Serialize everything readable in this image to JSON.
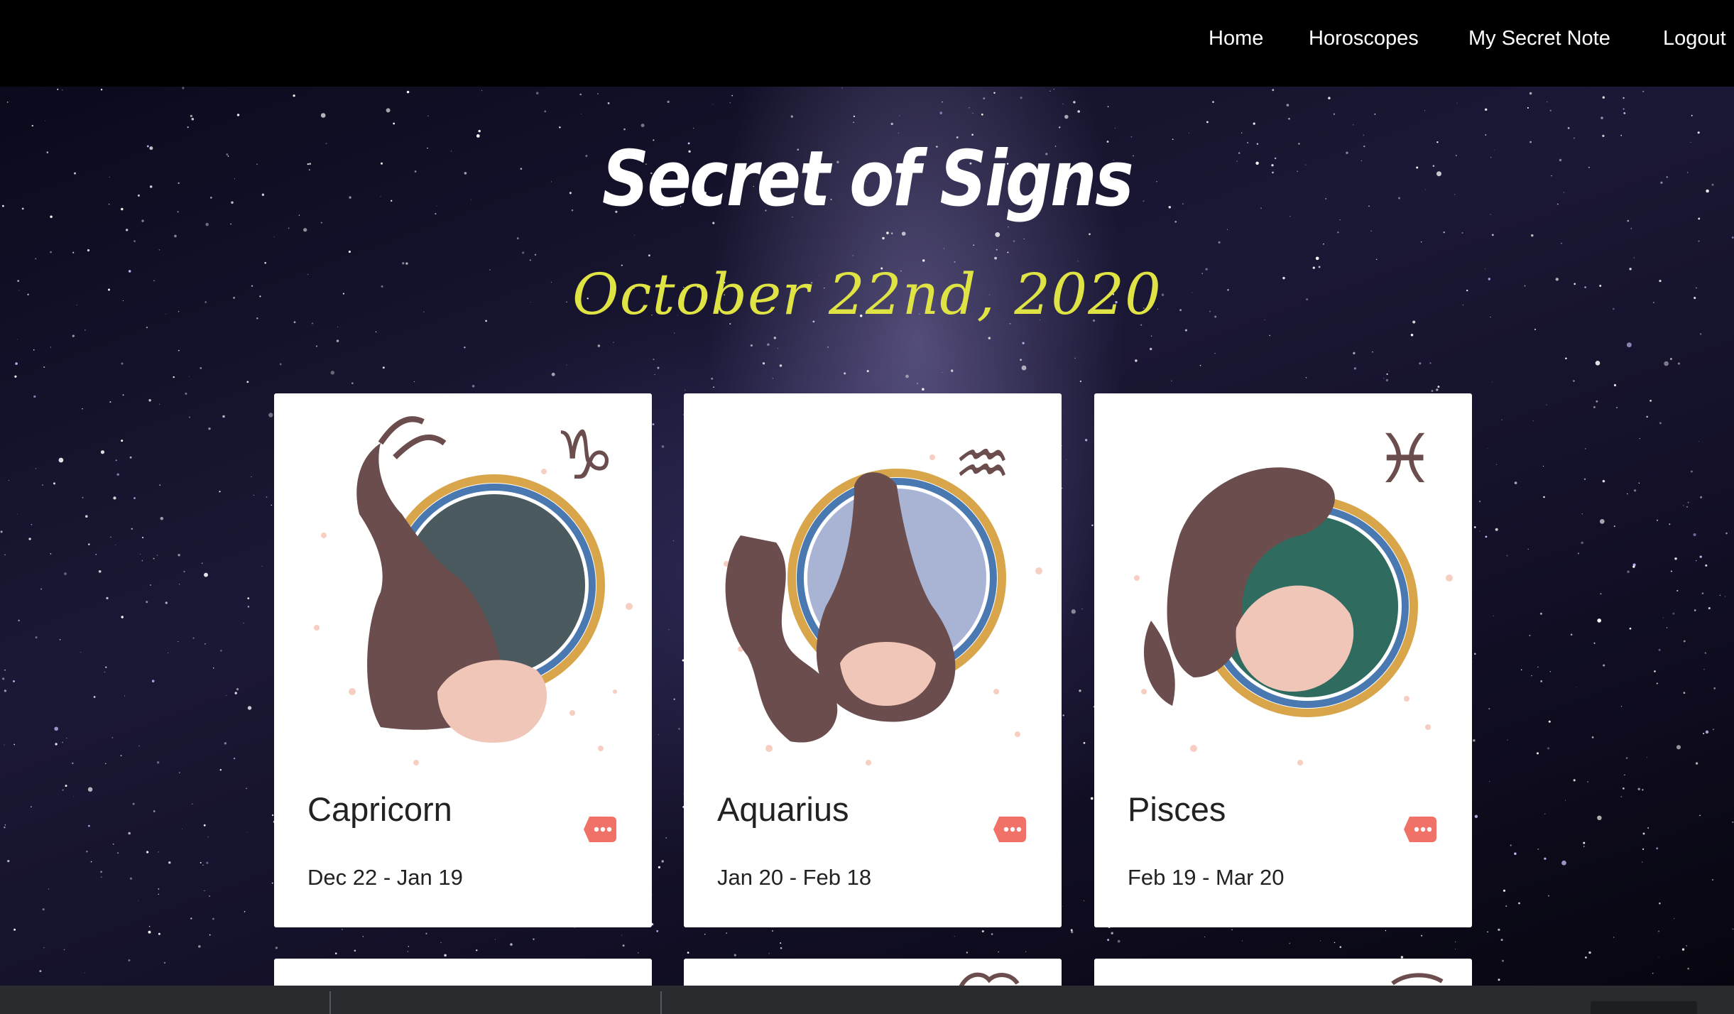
{
  "nav": {
    "links": [
      "Home",
      "Horoscopes",
      "My Secret Note",
      "Logout"
    ]
  },
  "hero": {
    "title": "Secret of Signs",
    "date": "October 22nd, 2020"
  },
  "cards": [
    {
      "name": "Capricorn",
      "range": "Dec 22 - Jan 19",
      "symbol": "capricorn-goat-icon",
      "more_icon": "more-dots-icon"
    },
    {
      "name": "Aquarius",
      "range": "Jan 20 - Feb 18",
      "symbol": "aquarius-jug-icon",
      "more_icon": "more-dots-icon"
    },
    {
      "name": "Pisces",
      "range": "Feb 19 - Mar 20",
      "symbol": "pisces-fish-icon",
      "more_icon": "more-dots-icon"
    }
  ],
  "colors": {
    "nav_bg": "#000000",
    "title": "#ffffff",
    "date": "#dfe344",
    "tag": "#f07167",
    "card_bg": "#ffffff"
  }
}
